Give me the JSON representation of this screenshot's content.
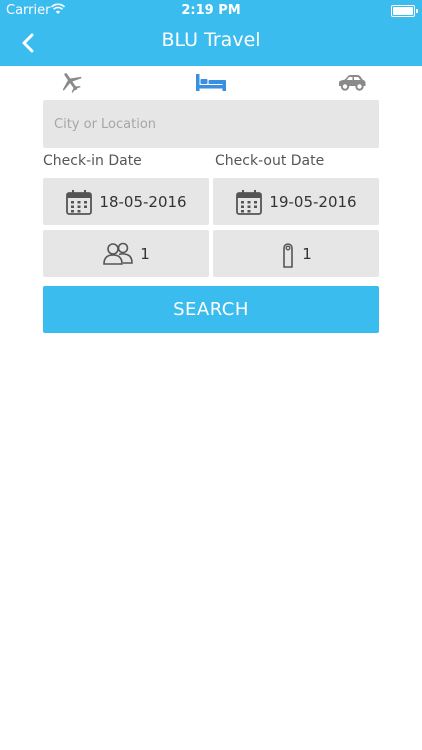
{
  "status_bar": {
    "carrier": "Carrier",
    "time": "2:19 PM"
  },
  "header": {
    "title": "BLU Travel",
    "back_icon": "chevron-left-icon"
  },
  "mode_tabs": [
    {
      "name": "flights",
      "icon": "airplane-icon",
      "active": false
    },
    {
      "name": "hotels",
      "icon": "bed-icon",
      "active": true
    },
    {
      "name": "cars",
      "icon": "car-icon",
      "active": false
    }
  ],
  "search_form": {
    "location_placeholder": "City or Location",
    "checkin_label": "Check-in Date",
    "checkout_label": "Check-out Date",
    "checkin_date": "18-05-2016",
    "checkout_date": "19-05-2016",
    "guests": "1",
    "rooms": "1",
    "search_label": "SEARCH"
  },
  "colors": {
    "accent": "#3bbcee",
    "active_icon": "#3a8fe0",
    "inactive_icon": "#8a8a8a",
    "field_bg": "#e6e6e6"
  }
}
